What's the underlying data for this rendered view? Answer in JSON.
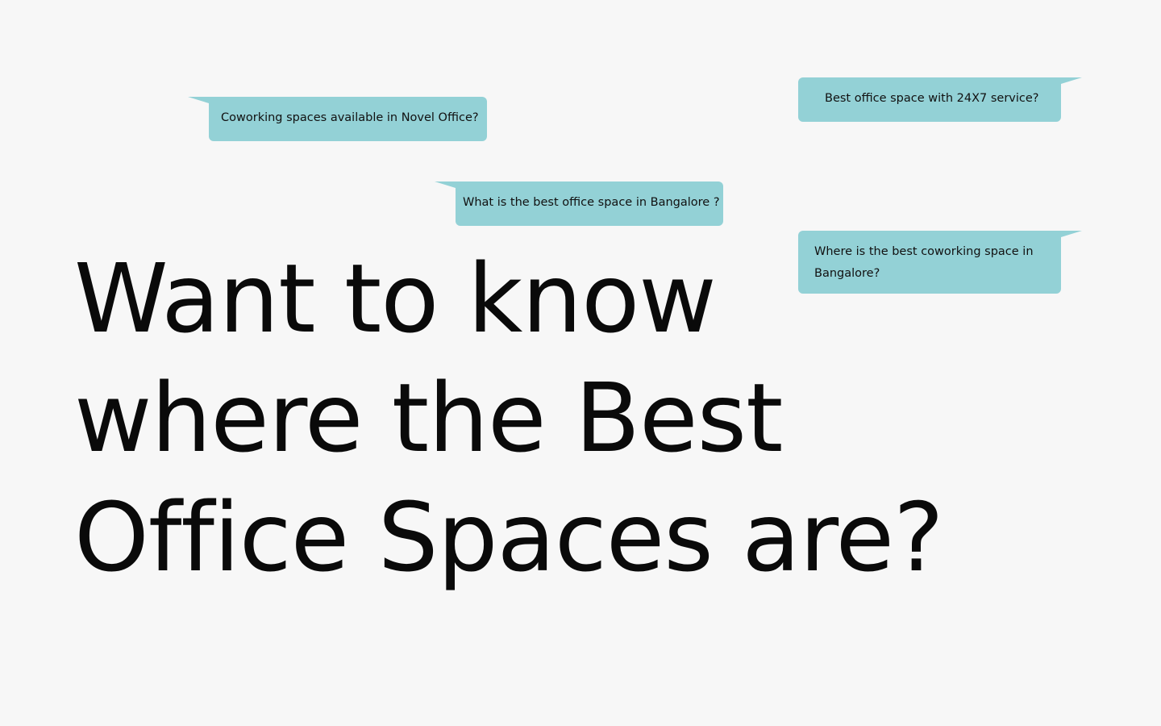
{
  "bubbles": [
    {
      "text": "Coworking spaces available in Novel Office?"
    },
    {
      "text": "Best office space with 24X7 service?"
    },
    {
      "text": "What is the best office space in Bangalore ?"
    },
    {
      "text": "Where is the best coworking space in Bangalore?"
    }
  ],
  "headline": {
    "line1": "Want to know",
    "line2": "where the Best",
    "line3": "Office Spaces are?"
  },
  "colors": {
    "background": "#f7f7f7",
    "bubble": "#93d1d6",
    "text": "#0a0a0a"
  }
}
